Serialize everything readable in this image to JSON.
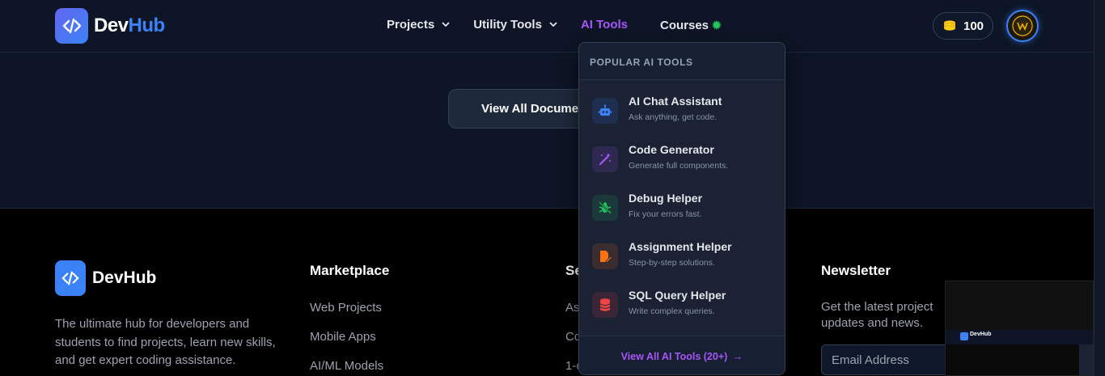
{
  "navbar": {
    "brand_dev": "Dev",
    "brand_hub": "Hub",
    "links": [
      {
        "label": "Projects"
      },
      {
        "label": "Utility Tools"
      },
      {
        "label": "AI Tools"
      },
      {
        "label": "Courses"
      }
    ],
    "coins": "100"
  },
  "hero": {
    "view_docs_label": "View All Documentation"
  },
  "ai_dropdown": {
    "header": "POPULAR AI TOOLS",
    "items": [
      {
        "title": "AI Chat Assistant",
        "desc": "Ask anything, get code.",
        "icon": "robot-icon",
        "color": "#3b82f6"
      },
      {
        "title": "Code Generator",
        "desc": "Generate full components.",
        "icon": "magic-wand-icon",
        "color": "#a855f7"
      },
      {
        "title": "Debug Helper",
        "desc": "Fix your errors fast.",
        "icon": "bug-slash-icon",
        "color": "#22c55e"
      },
      {
        "title": "Assignment Helper",
        "desc": "Step-by-step solutions.",
        "icon": "file-pen-icon",
        "color": "#f97316"
      },
      {
        "title": "SQL Query Helper",
        "desc": "Write complex queries.",
        "icon": "database-icon",
        "color": "#ef4444"
      }
    ],
    "footer_label": "View All AI Tools (20+)"
  },
  "footer": {
    "brand": "DevHub",
    "description": "The ultimate hub for developers and students to find projects, learn new skills, and get expert coding assistance.",
    "marketplace": {
      "title": "Marketplace",
      "links": [
        "Web Projects",
        "Mobile Apps",
        "AI/ML Models"
      ]
    },
    "services": {
      "title": "Se",
      "links": [
        "As",
        "Co",
        "1-o"
      ]
    },
    "newsletter": {
      "title": "Newsletter",
      "text": "Get the latest project updates and news.",
      "email_placeholder": "Email Address"
    }
  },
  "thumbnail": {
    "brand": "DevHub"
  }
}
